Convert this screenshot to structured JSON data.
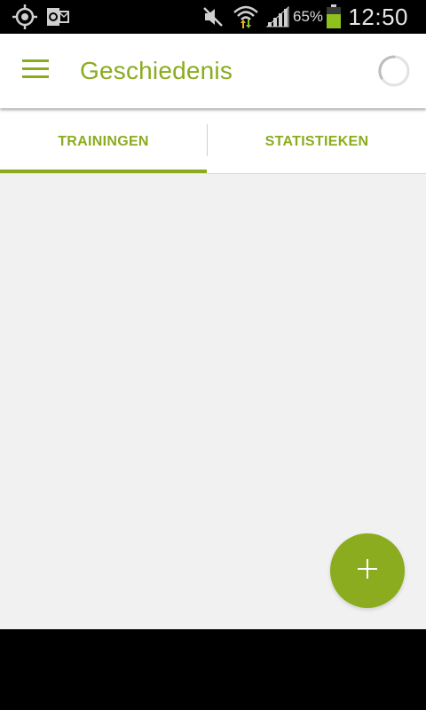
{
  "status_bar": {
    "icons": [
      "gps-icon",
      "outlook-icon",
      "mute-icon",
      "wifi-icon",
      "signal-icon",
      "battery-icon"
    ],
    "battery_percent": "65%",
    "battery_level": 0.65,
    "clock": "12:50"
  },
  "toolbar": {
    "menu_icon": "hamburger-menu-icon",
    "title": "Geschiedenis",
    "loading_icon": "loading-spinner-icon"
  },
  "tabs": [
    {
      "label": "TRAININGEN",
      "selected": true
    },
    {
      "label": "STATISTIEKEN",
      "selected": false
    }
  ],
  "content": {
    "items": []
  },
  "fab": {
    "icon": "plus-icon"
  },
  "colors": {
    "accent": "#8aac1e",
    "background": "#f1f1f1",
    "toolbar": "#ffffff",
    "status_bar": "#000000",
    "battery": "#8ec11e"
  }
}
